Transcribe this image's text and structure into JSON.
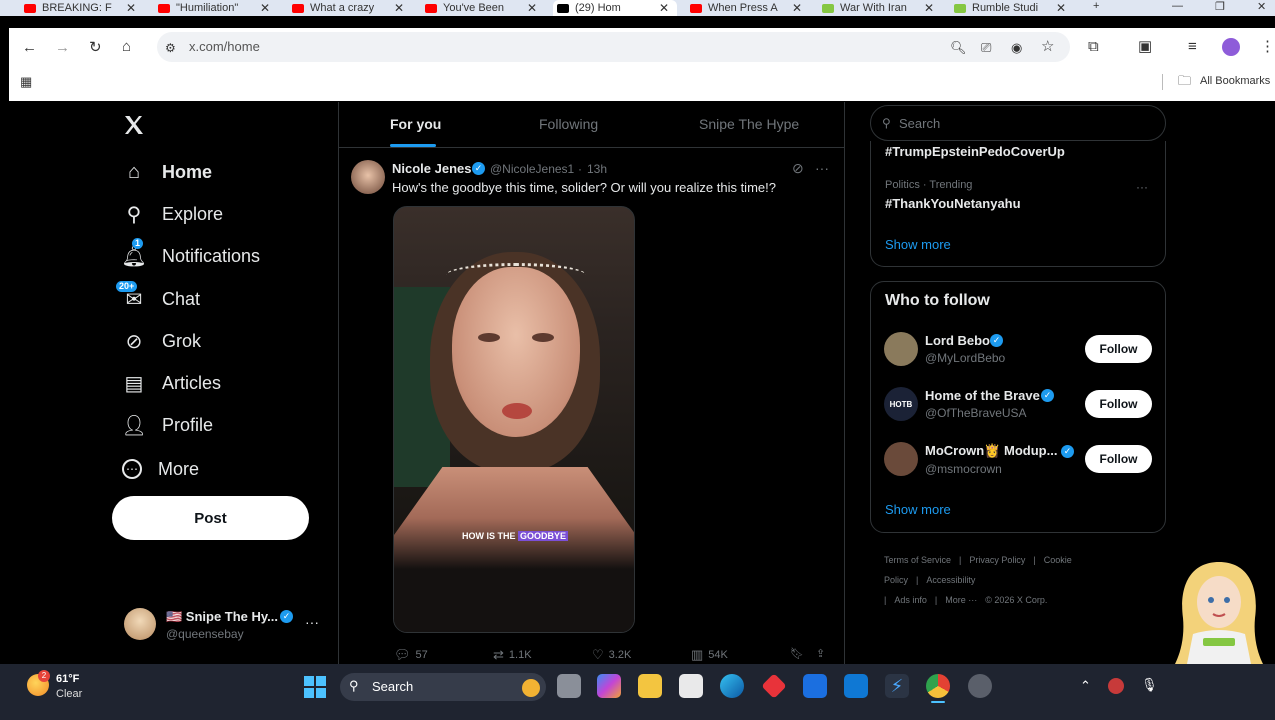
{
  "browser": {
    "tabs": [
      {
        "title": "BREAKING: Fl",
        "favicon_color": "#ff0000"
      },
      {
        "title": "\"Humiliation\"",
        "favicon_color": "#ff0000"
      },
      {
        "title": "What a crazy",
        "favicon_color": "#ff0000"
      },
      {
        "title": "You've Been",
        "favicon_color": "#ff0000"
      },
      {
        "title": "(29) Hom",
        "favicon_color": "#000000"
      },
      {
        "title": "When Press A",
        "favicon_color": "#ff0000"
      },
      {
        "title": "War With Iran",
        "favicon_color": "#85c742"
      },
      {
        "title": "Rumble Studi",
        "favicon_color": "#85c742"
      }
    ],
    "new_tab_symbol": "+",
    "address": "x.com/home",
    "bookmarks_label": "All Bookmarks"
  },
  "x_nav": {
    "items": [
      {
        "label": "Home",
        "icon": "home-icon",
        "badge": ""
      },
      {
        "label": "Explore",
        "icon": "search-icon",
        "badge": ""
      },
      {
        "label": "Notifications",
        "icon": "bell-icon",
        "badge": "1"
      },
      {
        "label": "Chat",
        "icon": "mail-icon",
        "badge": "20+"
      },
      {
        "label": "Grok",
        "icon": "grok-icon",
        "badge": ""
      },
      {
        "label": "Articles",
        "icon": "articles-icon",
        "badge": ""
      },
      {
        "label": "Profile",
        "icon": "person-icon",
        "badge": ""
      },
      {
        "label": "More",
        "icon": "more-circle-icon",
        "badge": ""
      }
    ],
    "post_label": "Post",
    "account": {
      "name": "🇺🇸 Snipe The Hy...",
      "handle": "@queensebay"
    }
  },
  "feed": {
    "tabs": [
      "For you",
      "Following",
      "Snipe The Hype"
    ],
    "active_tab": "For you",
    "post": {
      "author": "Nicole Jenes",
      "handle": "@NicoleJenes1",
      "time": "13h",
      "text": "How's the goodbye this time, solider? Or will you realize this time!?",
      "caption_white": "HOW IS THE",
      "caption_highlight": "GOODBYE",
      "replies": "57",
      "reposts": "1.1K",
      "likes": "3.2K",
      "views": "54K"
    }
  },
  "sidebar": {
    "search_placeholder": "Search",
    "trends": [
      {
        "context": "",
        "topic": "#TrumpEpsteinPedoCoverUp"
      },
      {
        "context": "Politics · Trending",
        "topic": "#ThankYouNetanyahu"
      }
    ],
    "show_more": "Show more",
    "who_to_follow": {
      "title": "Who to follow",
      "accounts": [
        {
          "name": "Lord Bebo",
          "handle": "@MyLordBebo",
          "avatar_color": "#8a7a5c"
        },
        {
          "name": "Home of the Brave",
          "handle": "@OfTheBraveUSA",
          "avatar_color": "#1b2236",
          "avatar_text": "HOTB"
        },
        {
          "name": "MoCrown👸 Modup...",
          "handle": "@msmocrown",
          "avatar_color": "#6a4a3a"
        }
      ],
      "follow_label": "Follow",
      "show_more": "Show more"
    },
    "footer": [
      "Terms of Service",
      "|",
      "Privacy Policy",
      "|",
      "Cookie Policy",
      "|",
      "Accessibility",
      "|",
      "Ads info",
      "|",
      "More ···",
      "© 2026 X Corp."
    ]
  },
  "taskbar": {
    "weather_temp": "61°F",
    "weather_desc": "Clear",
    "weather_badge": "2",
    "search_label": "Search"
  }
}
